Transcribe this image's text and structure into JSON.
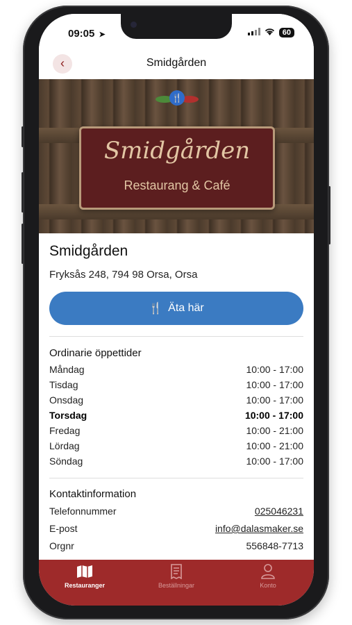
{
  "status_bar": {
    "time": "09:05",
    "battery": "60"
  },
  "nav": {
    "title": "Smidgården"
  },
  "hero": {
    "sign_title": "Smidgården",
    "sign_subtitle": "Restaurang & Café"
  },
  "restaurant": {
    "name": "Smidgården",
    "address": "Fryksås 248, 794 98 Orsa, Orsa",
    "eat_here_label": "Äta här"
  },
  "hours": {
    "title": "Ordinarie öppettider",
    "days": [
      {
        "day": "Måndag",
        "time": "10:00 - 17:00",
        "today": false
      },
      {
        "day": "Tisdag",
        "time": "10:00 - 17:00",
        "today": false
      },
      {
        "day": "Onsdag",
        "time": "10:00 - 17:00",
        "today": false
      },
      {
        "day": "Torsdag",
        "time": "10:00 - 17:00",
        "today": true
      },
      {
        "day": "Fredag",
        "time": "10:00 - 21:00",
        "today": false
      },
      {
        "day": "Lördag",
        "time": "10:00 - 21:00",
        "today": false
      },
      {
        "day": "Söndag",
        "time": "10:00 - 17:00",
        "today": false
      }
    ]
  },
  "contact": {
    "title": "Kontaktinformation",
    "phone_label": "Telefonnummer",
    "phone_value": "025046231",
    "email_label": "E-post",
    "email_value": "info@dalasmaker.se",
    "orgnr_label": "Orgnr",
    "orgnr_value": "556848-7713"
  },
  "tabs": [
    {
      "label": "Restauranger",
      "icon": "map-icon",
      "active": true
    },
    {
      "label": "Beställningar",
      "icon": "receipt-icon",
      "active": false
    },
    {
      "label": "Konto",
      "icon": "person-icon",
      "active": false
    }
  ],
  "colors": {
    "accent": "#9e2a2a",
    "button": "#3b7bc2"
  }
}
